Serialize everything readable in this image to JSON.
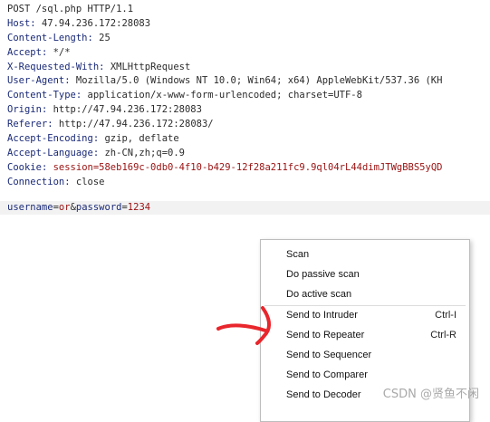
{
  "request": {
    "request_line": "POST /sql.php HTTP/1.1",
    "headers": [
      {
        "name": "Host",
        "value": "47.94.236.172:28083"
      },
      {
        "name": "Content-Length",
        "value": "25"
      },
      {
        "name": "Accept",
        "value": "*/*"
      },
      {
        "name": "X-Requested-With",
        "value": "XMLHttpRequest"
      },
      {
        "name": "User-Agent",
        "value": "Mozilla/5.0 (Windows NT 10.0; Win64; x64) AppleWebKit/537.36 (KH"
      },
      {
        "name": "Content-Type",
        "value": "application/x-www-form-urlencoded; charset=UTF-8"
      },
      {
        "name": "Origin",
        "value": "http://47.94.236.172:28083"
      },
      {
        "name": "Referer",
        "value": "http://47.94.236.172:28083/"
      },
      {
        "name": "Accept-Encoding",
        "value": "gzip, deflate"
      },
      {
        "name": "Accept-Language",
        "value": "zh-CN,zh;q=0.9"
      },
      {
        "name": "Cookie",
        "value": "session=58eb169c-0db0-4f10-b429-12f28a211fc9.9ql04rL44dimJTWgBBS5yQD"
      },
      {
        "name": "Connection",
        "value": "close"
      }
    ],
    "body": {
      "key1": "username",
      "eq1": "=",
      "val1": "or",
      "amp": "&",
      "key2": "password",
      "eq2": "=",
      "val2": "1234"
    }
  },
  "context_menu": {
    "items": [
      {
        "label": "Scan",
        "shortcut": ""
      },
      {
        "label": "Do passive scan",
        "shortcut": ""
      },
      {
        "label": "Do active scan",
        "shortcut": ""
      },
      {
        "label": "Send to Intruder",
        "shortcut": "Ctrl-I"
      },
      {
        "label": "Send to Repeater",
        "shortcut": "Ctrl-R"
      },
      {
        "label": "Send to Sequencer",
        "shortcut": ""
      },
      {
        "label": "Send to Comparer",
        "shortcut": ""
      },
      {
        "label": "Send to Decoder",
        "shortcut": ""
      }
    ]
  },
  "watermark": "CSDN @贤鱼不闲",
  "annotation_color": "#e8262c",
  "colors": {
    "header_name": "#1a2a78",
    "value_red": "#9a1111",
    "menu_border": "#bdbdbd"
  }
}
